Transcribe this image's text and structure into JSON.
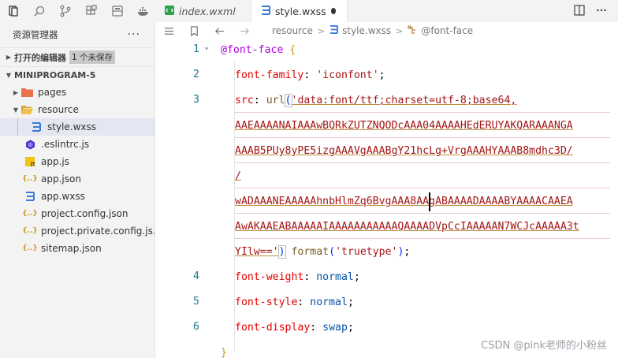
{
  "activity_bar": {
    "icons": [
      "explorer-icon",
      "search-icon",
      "source-control-icon",
      "extensions-icon",
      "storage-icon",
      "docker-icon"
    ]
  },
  "sidebar": {
    "title": "资源管理器",
    "more": "···",
    "open_editors": {
      "label": "打开的编辑器",
      "badge": "1 个未保存"
    },
    "project": {
      "label": "MINIPROGRAM-5"
    },
    "items": [
      {
        "label": "pages",
        "type": "folder"
      },
      {
        "label": "resource",
        "type": "folder-open"
      },
      {
        "label": "style.wxss",
        "type": "css"
      },
      {
        "label": ".eslintrc.js",
        "type": "eslint"
      },
      {
        "label": "app.js",
        "type": "js"
      },
      {
        "label": "app.json",
        "type": "json"
      },
      {
        "label": "app.wxss",
        "type": "css"
      },
      {
        "label": "project.config.json",
        "type": "json"
      },
      {
        "label": "project.private.config.js...",
        "type": "json"
      },
      {
        "label": "sitemap.json",
        "type": "json"
      }
    ]
  },
  "tabs": [
    {
      "label": "index.wxml",
      "active": false
    },
    {
      "label": "style.wxss",
      "active": true,
      "unsaved": true
    }
  ],
  "breadcrumb": {
    "items": [
      "resource",
      "style.wxss",
      "@font-face"
    ]
  },
  "editor": {
    "line_numbers": [
      "1",
      "2",
      "3",
      "4",
      "5",
      "6"
    ],
    "code": {
      "l1_at": "@font-face",
      "l1_brace": " {",
      "l2_prop": "font-family",
      "l2_colon": ": ",
      "l2_val": "'iconfont'",
      "l2_semi": ";",
      "l3_prop": "src",
      "l3_colon": ": ",
      "l3_fn": "url",
      "l3_paren": "(",
      "wrap1": "'data:font/ttf;charset=utf-8;base64,",
      "wrap2": "AAEAAAANAIAAAwBQRkZUTZNQODcAAA04AAAAHEdERUYAKQARAAANGA",
      "wrap3": "AAAB5PUy8yPE5izgAAAVgAAABgY21hcLg+VrgAAAHYAAAB8mdhc3D/",
      "wrap4": "/",
      "wrap5": "wADAAANEAAAAAhnbHlmZq6BvgAAA8AAgABAAAADAAAABYAAAACAAEA",
      "wrap6": "AwAKAAEABAAAAAIAAAAAAAAAAAQAAAADVpCcIAAAAAN7WCJcAAAAA3t",
      "wrap7a": "YIlw=='",
      "wrap7b": ")",
      "wrap7c": " format",
      "wrap7d": "(",
      "wrap7e": "'truetype'",
      "wrap7f": ")",
      "wrap7g": ";",
      "l4_prop": "font-weight",
      "l4_colon": ": ",
      "l4_val": "normal",
      "l4_semi": ";",
      "l5_prop": "font-style",
      "l5_colon": ": ",
      "l5_val": "normal",
      "l5_semi": ";",
      "l6_prop": "font-display",
      "l6_colon": ": ",
      "l6_val": "swap",
      "l6_semi": ";",
      "l7_brace": "}"
    }
  },
  "watermark": "CSDN @pink老师的小粉丝"
}
